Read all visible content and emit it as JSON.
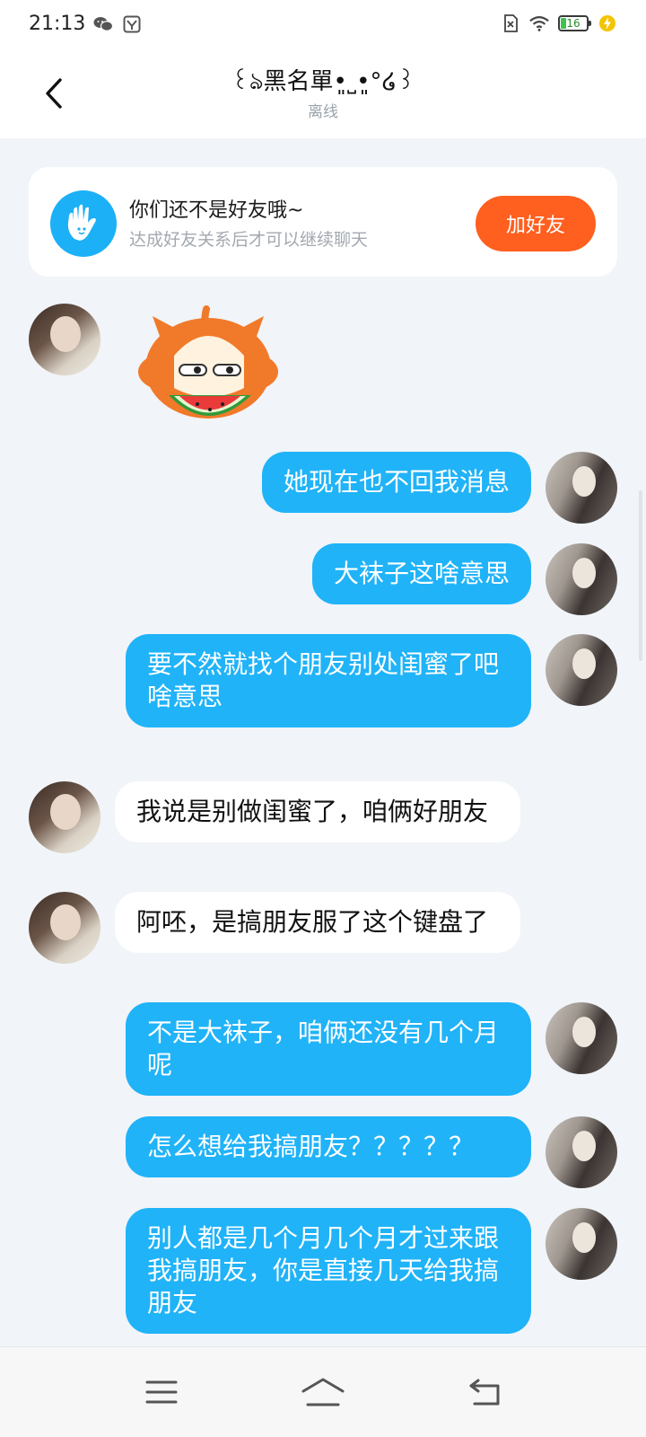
{
  "status_bar": {
    "time": "21:13",
    "left_icons": [
      "wechat-icon",
      "gallery-icon"
    ],
    "right_icons": [
      "sim-off-icon",
      "wifi-icon",
      "battery-icon",
      "charging-icon"
    ],
    "battery_level": "16"
  },
  "header": {
    "title": "꒰ঌ黑名單•͈˽•͈°໒꒱",
    "status": "离线"
  },
  "friend_banner": {
    "title": "你们还不是好友哦~",
    "description": "达成好友关系后才可以继续聊天",
    "add_button": "加好友",
    "icon": "hand-wave-icon",
    "colors": {
      "icon_bg": "#1cb0f6",
      "button_bg": "#ff5f1f"
    }
  },
  "messages": [
    {
      "from": "other",
      "type": "sticker",
      "sticker": "orange-cat-eating-watermelon-sticker"
    },
    {
      "from": "me",
      "text": "她现在也不回我消息"
    },
    {
      "from": "me",
      "text": "大袜子这啥意思"
    },
    {
      "from": "me",
      "text": "要不然就找个朋友别处闺蜜了吧\n啥意思"
    },
    {
      "from": "other",
      "text": "我说是别做闺蜜了，咱俩好朋友"
    },
    {
      "from": "other",
      "text": "阿呸，是搞朋友服了这个键盘了"
    },
    {
      "from": "me",
      "text": "不是大袜子，咱俩还没有几个月呢"
    },
    {
      "from": "me",
      "text": "怎么想给我搞朋友？？？？？"
    },
    {
      "from": "me",
      "text": "别人都是几个月几个月才过来跟我搞朋友，你是直接几天给我搞朋友"
    }
  ],
  "colors": {
    "my_bubble": "#20b3f8",
    "other_bubble": "#ffffff",
    "background": "#f1f4f8"
  },
  "nav_bar": {
    "icons": [
      "menu-icon",
      "home-icon",
      "back-nav-icon"
    ]
  }
}
